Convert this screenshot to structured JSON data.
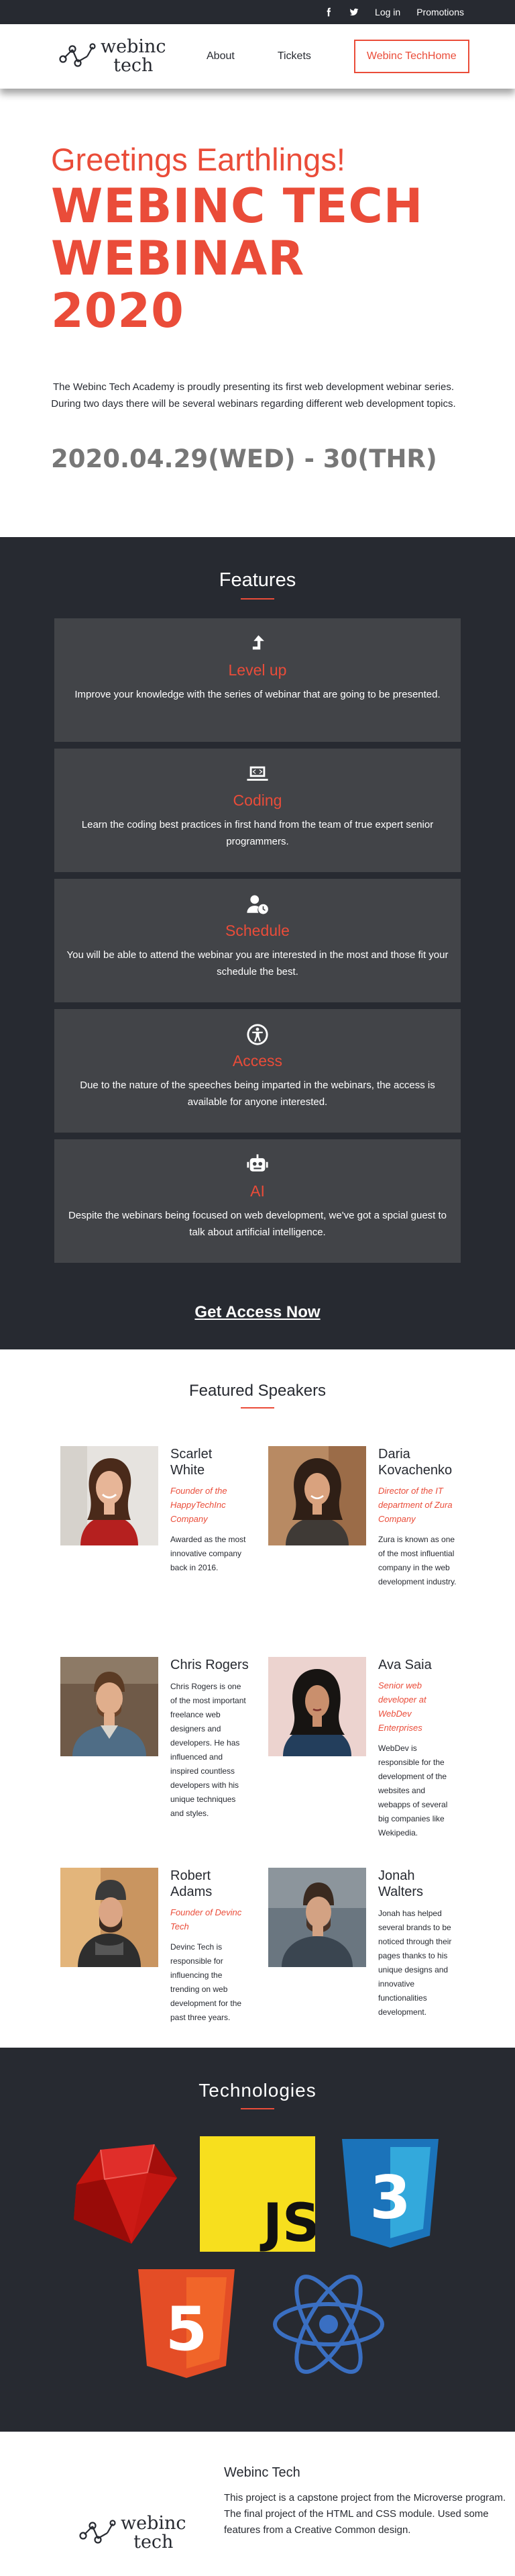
{
  "topbar": {
    "login": "Log in",
    "promotions": "Promotions"
  },
  "header": {
    "logo_line1": "webinc",
    "logo_line2": "tech",
    "nav": {
      "about": "About",
      "tickets": "Tickets",
      "home": "Webinc TechHome"
    }
  },
  "hero": {
    "greeting": "Greetings Earthlings!",
    "title_line1": "WEBINC TECH",
    "title_line2": "WEBINAR",
    "title_line3": "2020",
    "intro_line1": "The Webinc Tech Academy is proudly presenting its first web development webinar series.",
    "intro_line2": "During two days there will be several webinars regarding different web development topics.",
    "dates": "2020.04.29(WED) - 30(THR)"
  },
  "features": {
    "title": "Features",
    "items": [
      {
        "icon": "level-up-icon",
        "title": "Level up",
        "desc": "Improve your knowledge with the series of webinar that are going to be presented."
      },
      {
        "icon": "laptop-code-icon",
        "title": "Coding",
        "desc": "Learn the coding best practices in first hand from the team of true expert senior programmers."
      },
      {
        "icon": "user-clock-icon",
        "title": "Schedule",
        "desc": "You will be able to attend the webinar you are interested in the most and those fit your schedule the best."
      },
      {
        "icon": "accessibility-icon",
        "title": "Access",
        "desc": "Due to the nature of the speeches being imparted in the webinars, the access is available for anyone interested."
      },
      {
        "icon": "robot-icon",
        "title": "AI",
        "desc": "Despite the webinars being focused on web development, we've got a spcial guest to talk about artificial intelligence."
      }
    ],
    "cta": "Get Access Now"
  },
  "speakers": {
    "title": "Featured Speakers",
    "items": [
      {
        "name": "Scarlet White",
        "role": "Founder of the HappyTechInc Company",
        "bio": "Awarded as the most innovative company back in 2016."
      },
      {
        "name": "Daria Kovachenko",
        "role": "Director of the IT department of Zura Company",
        "bio": "Zura is known as one of the most influential company in the web development industry."
      },
      {
        "name": "Chris Rogers",
        "role": "",
        "bio": "Chris Rogers is one of the most important freelance web designers and developers. He has influenced and inspired countless developers with his unique techniques and styles."
      },
      {
        "name": "Ava Saia",
        "role": "Senior web developer at WebDev Enterprises",
        "bio": "WebDev is responsible for the development of the websites and webapps of several big companies like Wekipedia."
      },
      {
        "name": "Robert Adams",
        "role": "Founder of Devinc Tech",
        "bio": "Devinc Tech is responsible for influencing the trending on web development for the past three years."
      },
      {
        "name": "Jonah Walters",
        "role": "",
        "bio": "Jonah has helped several brands to be noticed through their pages thanks to his unique designs and innovative functionalities development."
      }
    ]
  },
  "technologies": {
    "title": "Technologies",
    "logos": [
      "ruby-logo",
      "javascript-logo",
      "css3-logo",
      "html5-logo",
      "react-logo"
    ],
    "js_text": "JS",
    "css_number": "3",
    "html_number": "5"
  },
  "footer": {
    "title": "Webinc Tech",
    "text": "This project is a capstone project from the Microverse program. The final project of the HTML and CSS module. Used some features from a Creative Common design."
  },
  "colors": {
    "accent": "#ea4c39",
    "dark": "#272a31",
    "card": "#424448"
  }
}
